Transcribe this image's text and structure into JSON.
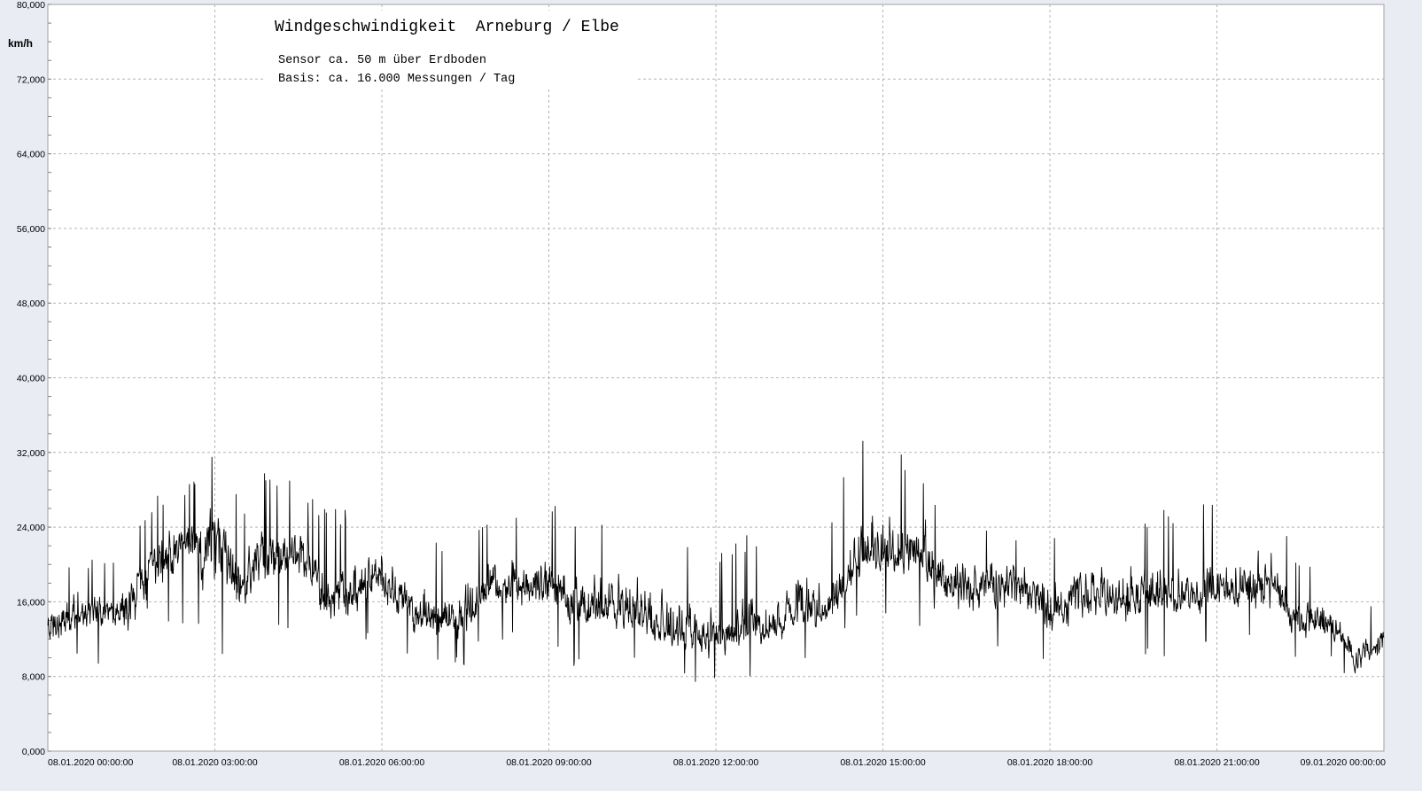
{
  "chart_data": {
    "type": "line",
    "title": "Windgeschwindigkeit  Arneburg / Elbe",
    "subtitle_lines": [
      "Sensor ca. 50 m über Erdboden",
      "Basis: ca. 16.000 Messungen / Tag"
    ],
    "ylabel": "km/h",
    "xlabel": "",
    "ylim": [
      0,
      80
    ],
    "y_ticks": [
      {
        "value": 0,
        "label": "0,000"
      },
      {
        "value": 8,
        "label": "8,000"
      },
      {
        "value": 16,
        "label": "16,000"
      },
      {
        "value": 24,
        "label": "24,000"
      },
      {
        "value": 32,
        "label": "32,000"
      },
      {
        "value": 40,
        "label": "40,000"
      },
      {
        "value": 48,
        "label": "48,000"
      },
      {
        "value": 56,
        "label": "56,000"
      },
      {
        "value": 64,
        "label": "64,000"
      },
      {
        "value": 72,
        "label": "72,000"
      },
      {
        "value": 80,
        "label": "80,000"
      }
    ],
    "xlim_hours": [
      0,
      24
    ],
    "x_ticks": [
      {
        "hour": 0,
        "label": "08.01.2020  00:00:00"
      },
      {
        "hour": 3,
        "label": "08.01.2020  03:00:00"
      },
      {
        "hour": 6,
        "label": "08.01.2020  06:00:00"
      },
      {
        "hour": 9,
        "label": "08.01.2020  09:00:00"
      },
      {
        "hour": 12,
        "label": "08.01.2020  12:00:00"
      },
      {
        "hour": 15,
        "label": "08.01.2020  15:00:00"
      },
      {
        "hour": 18,
        "label": "08.01.2020  18:00:00"
      },
      {
        "hour": 21,
        "label": "08.01.2020  21:00:00"
      },
      {
        "hour": 24,
        "label": "09.01.2020  00:00:00"
      }
    ],
    "grid": true,
    "series": [
      {
        "color": "#000000",
        "envelope_hours": [
          0,
          0.5,
          1.0,
          1.5,
          2.0,
          2.5,
          3.0,
          3.5,
          4.0,
          4.5,
          5.0,
          5.5,
          6.0,
          6.5,
          7.0,
          7.5,
          8.0,
          8.5,
          9.0,
          9.5,
          10.0,
          10.5,
          11.0,
          11.5,
          12.0,
          12.5,
          13.0,
          13.5,
          14.0,
          14.5,
          15.0,
          15.5,
          16.0,
          16.5,
          17.0,
          17.5,
          18.0,
          18.5,
          19.0,
          19.5,
          20.0,
          20.5,
          21.0,
          21.5,
          22.0,
          22.5,
          23.0,
          23.5,
          24.0
        ],
        "mean_kmh": [
          13,
          15,
          15,
          16,
          21,
          22,
          23,
          18,
          21,
          22,
          16,
          17,
          19,
          15,
          14,
          14,
          18,
          17,
          18,
          15,
          15,
          15,
          13,
          13,
          12,
          13,
          13,
          15,
          15,
          20,
          21,
          21,
          19,
          18,
          18,
          18,
          15,
          16,
          17,
          16,
          17,
          17,
          17,
          17,
          18,
          14,
          14,
          10,
          12
        ],
        "max_kmh": [
          18,
          22,
          20,
          25,
          28,
          29,
          32,
          27,
          31,
          29,
          26,
          27,
          27,
          22,
          23,
          25,
          27,
          25,
          27,
          24,
          25,
          24,
          24,
          22,
          22,
          24,
          21,
          28,
          23,
          34,
          33,
          33,
          27,
          26,
          24,
          24,
          25,
          26,
          27,
          25,
          26,
          27,
          27,
          26,
          27,
          20,
          20,
          16,
          16
        ],
        "min_kmh": [
          7,
          9,
          9,
          6,
          11,
          13,
          9,
          10,
          13,
          13,
          10,
          11,
          12,
          9,
          9,
          9,
          12,
          11,
          10,
          9,
          10,
          9,
          7,
          7,
          7,
          8,
          8,
          9,
          10,
          13,
          14,
          14,
          11,
          10,
          10,
          10,
          8,
          9,
          10,
          10,
          10,
          10,
          11,
          11,
          11,
          9,
          10,
          6,
          8
        ]
      }
    ]
  }
}
